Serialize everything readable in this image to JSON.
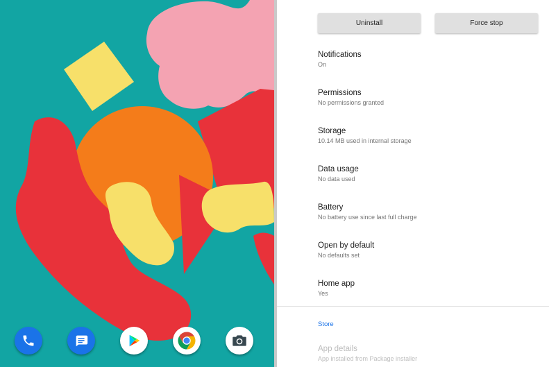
{
  "home": {
    "dock": [
      {
        "name": "Phone",
        "icon": "phone-icon",
        "color": "#1a73e8"
      },
      {
        "name": "Messages",
        "icon": "messages-icon",
        "color": "#1a73e8"
      },
      {
        "name": "Play Store",
        "icon": "play-store-icon",
        "color": "#ffffff"
      },
      {
        "name": "Chrome",
        "icon": "chrome-icon",
        "color": "#ffffff"
      },
      {
        "name": "Camera",
        "icon": "camera-icon",
        "color": "#ffffff"
      }
    ]
  },
  "settings": {
    "uninstall_label": "Uninstall",
    "force_stop_label": "Force stop",
    "prefs": [
      {
        "title": "Notifications",
        "summary": "On"
      },
      {
        "title": "Permissions",
        "summary": "No permissions granted"
      },
      {
        "title": "Storage",
        "summary": "10.14 MB used in internal storage"
      },
      {
        "title": "Data usage",
        "summary": "No data used"
      },
      {
        "title": "Battery",
        "summary": "No battery use since last full charge"
      },
      {
        "title": "Open by default",
        "summary": "No defaults set"
      },
      {
        "title": "Home app",
        "summary": "Yes"
      }
    ],
    "store_header": "Store",
    "app_details": {
      "title": "App details",
      "summary": "App installed from Package installer"
    },
    "accent_color": "#1a73e8"
  }
}
